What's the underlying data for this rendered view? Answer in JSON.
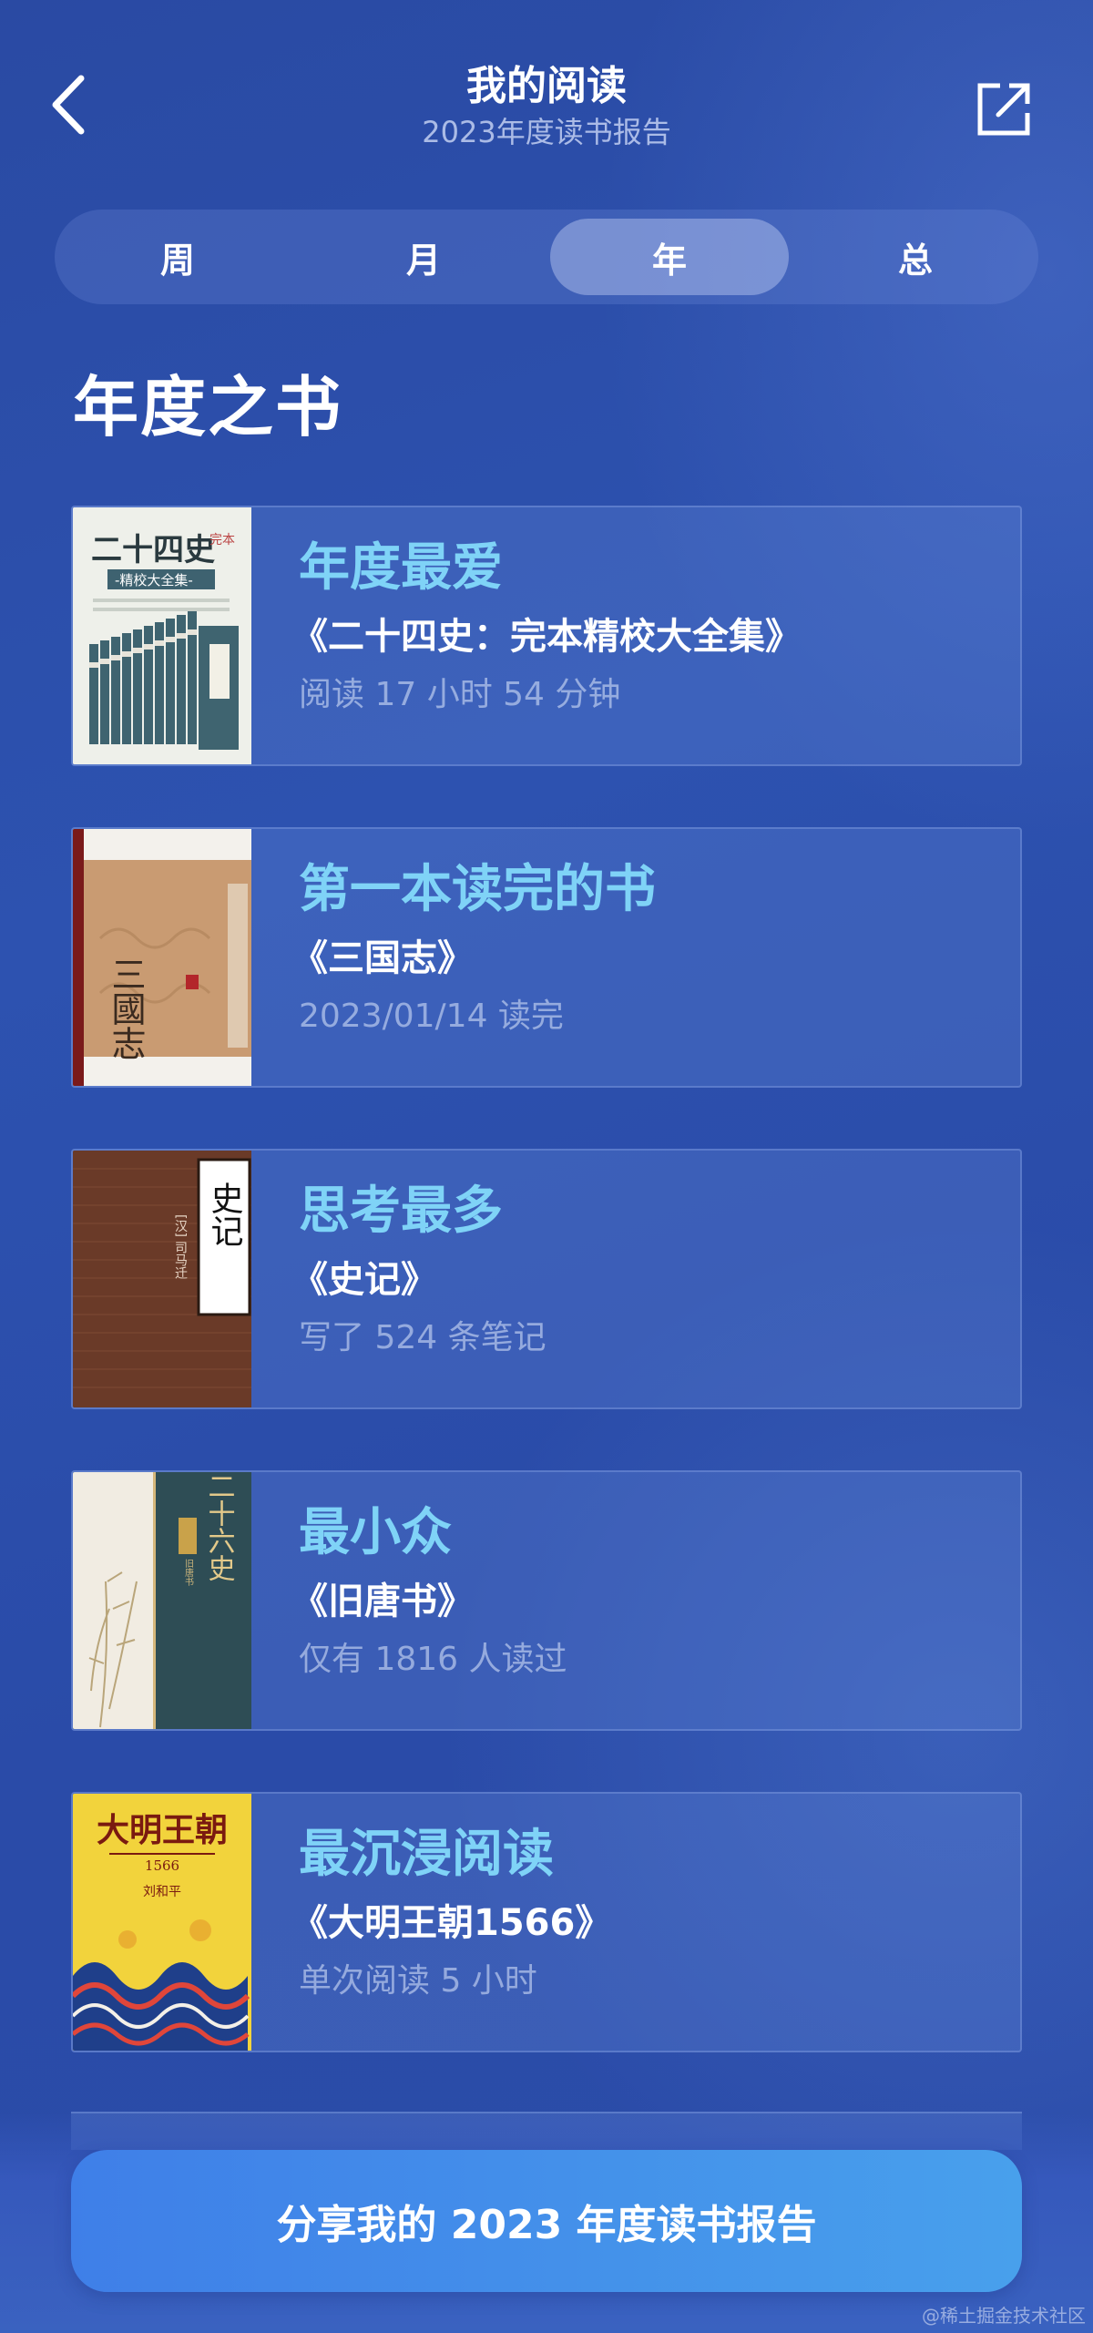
{
  "header": {
    "title": "我的阅读",
    "subtitle": "2023年度读书报告"
  },
  "tabs": [
    {
      "label": "周",
      "active": false
    },
    {
      "label": "月",
      "active": false
    },
    {
      "label": "年",
      "active": true
    },
    {
      "label": "总",
      "active": false
    }
  ],
  "section": {
    "title": "年度之书"
  },
  "cards": [
    {
      "label": "年度最爱",
      "book": "《二十四史：完本精校大全集》",
      "stat": "阅读 17 小时 54 分钟",
      "cover": {
        "title": "二十四史",
        "subtitle": "-精校大全集-",
        "tag": "完本"
      }
    },
    {
      "label": "第一本读完的书",
      "book": "《三国志》",
      "stat": "2023/01/14 读完",
      "cover": {
        "title": "三國志"
      }
    },
    {
      "label": "思考最多",
      "book": "《史记》",
      "stat": "写了 524 条笔记",
      "cover": {
        "title": "史记",
        "author": "[汉] 司马迁"
      }
    },
    {
      "label": "最小众",
      "book": "《旧唐书》",
      "stat": "仅有 1816 人读过",
      "cover": {
        "title": "二十六史",
        "tag": "旧唐书"
      }
    },
    {
      "label": "最沉浸阅读",
      "book": "《大明王朝1566》",
      "stat": "单次阅读 5 小时",
      "cover": {
        "title": "大明王朝",
        "subtitle": "1566",
        "author": "刘和平"
      }
    }
  ],
  "share_button": {
    "label": "分享我的 2023 年度读书报告"
  },
  "watermark": "@稀土掘金技术社区",
  "colors": {
    "background": "#2b4ca9",
    "accent_label": "#7fd3f7",
    "button_start": "#3f7fe8",
    "button_end": "#48a0ec"
  },
  "icons": {
    "back": "chevron-left-icon",
    "share": "share-external-icon"
  }
}
